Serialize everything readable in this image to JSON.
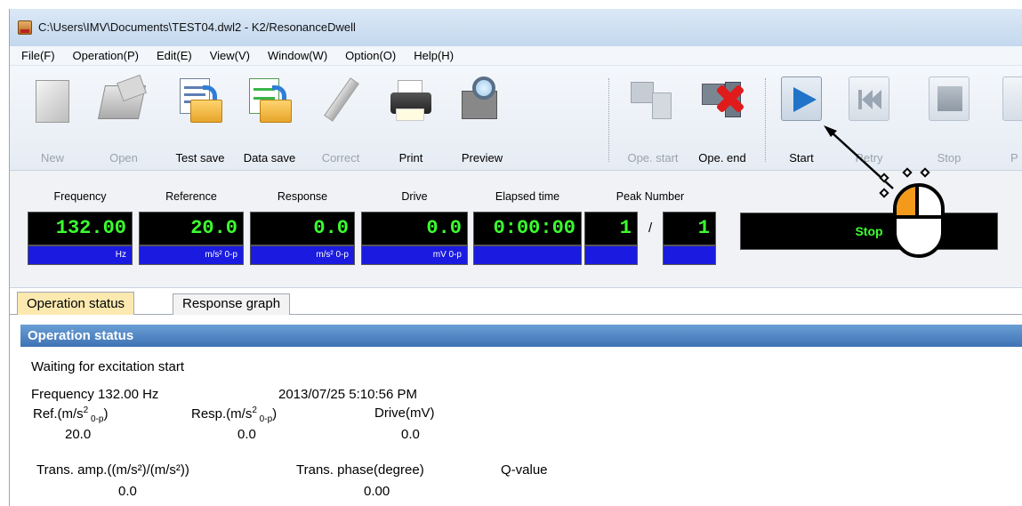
{
  "window": {
    "title": "C:\\Users\\IMV\\Documents\\TEST04.dwl2 - K2/ResonanceDwell"
  },
  "menu": [
    "File(F)",
    "Operation(P)",
    "Edit(E)",
    "View(V)",
    "Window(W)",
    "Option(O)",
    "Help(H)"
  ],
  "toolbar": {
    "new": "New",
    "open": "Open",
    "test_save": "Test save",
    "data_save": "Data save",
    "correct": "Correct",
    "print": "Print",
    "preview": "Preview",
    "ope_start": "Ope. start",
    "ope_end": "Ope. end",
    "start": "Start",
    "retry": "Retry",
    "stop": "Stop",
    "partial": "P"
  },
  "monitor": {
    "frequency": {
      "label": "Frequency",
      "value": "132.00",
      "unit": "Hz"
    },
    "reference": {
      "label": "Reference",
      "value": "20.0",
      "unit": "m/s² 0-p"
    },
    "response": {
      "label": "Response",
      "value": "0.0",
      "unit": "m/s² 0-p"
    },
    "drive": {
      "label": "Drive",
      "value": "0.0",
      "unit": "mV 0-p"
    },
    "elapsed": {
      "label": "Elapsed time",
      "value": "0:00:00",
      "unit": ""
    },
    "peak": {
      "label": "Peak Number",
      "current": "1",
      "slash": "/",
      "total": "1"
    },
    "state": "Stop"
  },
  "tabs": {
    "operation_status": "Operation status",
    "response_graph": "Response graph"
  },
  "status": {
    "header": "Operation status",
    "message": "Waiting for excitation start",
    "frequency": "Frequency 132.00 Hz",
    "datetime": "2013/07/25 5:10:56 PM",
    "ref_label": "Ref.(m/s",
    "ref_sup": "2",
    "ref_sub": " 0-p",
    "ref_close": ")",
    "resp_label": "Resp.(m/s",
    "resp_sup": "2",
    "resp_sub": " 0-p",
    "resp_close": ")",
    "drive_label": "Drive(mV)",
    "ref_value": "20.0",
    "resp_value": "0.0",
    "drive_value": "0.0",
    "trans_amp_label": "Trans. amp.((m/s²)/(m/s²))",
    "trans_phase_label": "Trans. phase(degree)",
    "q_label": "Q-value",
    "trans_amp_value": "0.0",
    "trans_phase_value": "0.00"
  },
  "colors": {
    "display_bg": "#000000",
    "display_text": "#3cff2f",
    "unit_bg": "#1a1ae0",
    "status_header": "#3e72b4",
    "active_tab": "#fbe9b0",
    "mouse_left_button": "#f39a1b"
  },
  "icons": {
    "app": "app-icon",
    "start": "play-icon",
    "annotation": "mouse-left-click-icon"
  }
}
